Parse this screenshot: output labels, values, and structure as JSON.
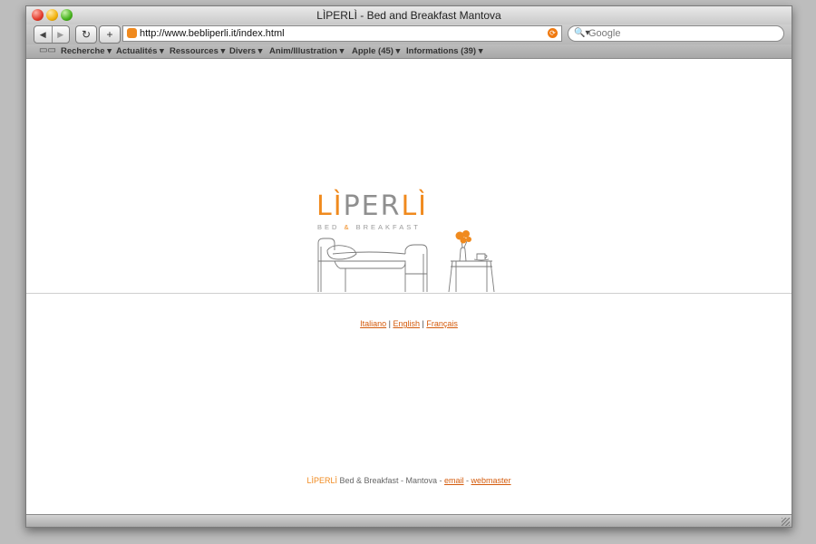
{
  "window": {
    "title": "LÌPERLÌ - Bed and Breakfast Mantova"
  },
  "toolbar": {
    "back_icon": "◀",
    "forward_icon": "▶",
    "reload_icon": "↻",
    "add_icon": "+",
    "url": "http://www.bebliperli.it/index.html",
    "search_placeholder": "Google",
    "search_icon": "🔍▾"
  },
  "bookmarks": {
    "book_icon": "📖",
    "items": [
      "Recherche ▾",
      "Actualités ▾",
      "Ressources ▾",
      "Divers ▾",
      "Anim/Illustration ▾",
      "Apple (45) ▾",
      "Informations (39) ▾"
    ]
  },
  "page": {
    "logo": {
      "part1": "LÌ",
      "part2": "PER",
      "part3": "LÌ",
      "tagline_part1": "BED ",
      "tagline_amp": "&",
      "tagline_part2": " BREAKFAST"
    },
    "languages": [
      "Italiano",
      "English",
      "Français"
    ],
    "separator": " | ",
    "footer": {
      "brand": "LÌPERLÌ",
      "text": " Bed & Breakfast - Mantova - ",
      "email": "email",
      "dash": " - ",
      "webmaster": "webmaster"
    }
  },
  "colors": {
    "accent_orange": "#f08a1e",
    "link": "#d45b0c",
    "logo_gray": "#8f8f8f"
  }
}
